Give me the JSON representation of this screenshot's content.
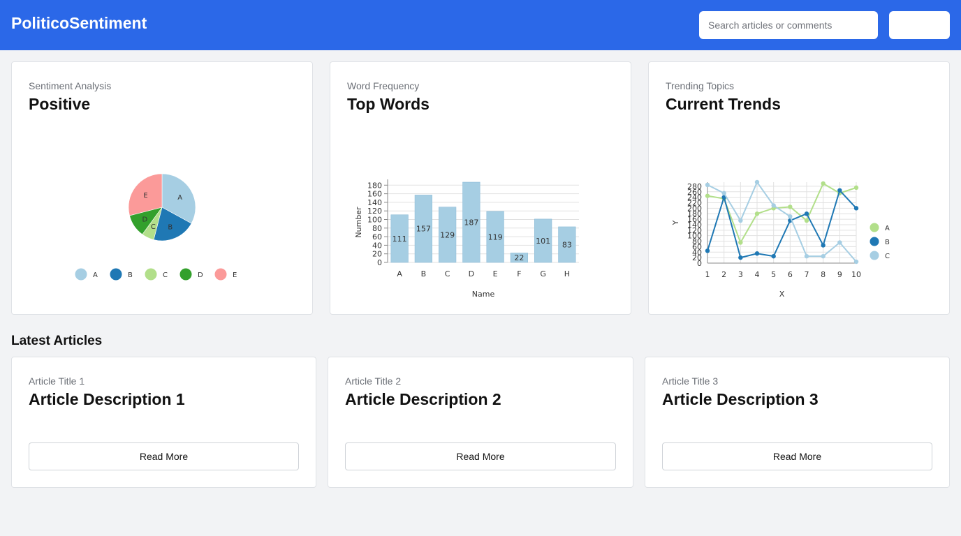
{
  "app": {
    "brand": "PoliticoSentiment",
    "search_placeholder": "Search articles or comments",
    "header_button_label": ""
  },
  "cards": [
    {
      "subtitle": "Sentiment Analysis",
      "title": "Positive"
    },
    {
      "subtitle": "Word Frequency",
      "title": "Top Words"
    },
    {
      "subtitle": "Trending Topics",
      "title": "Current Trends"
    }
  ],
  "latest": {
    "heading": "Latest Articles",
    "articles": [
      {
        "title": "Article Title 1",
        "description": "Article Description 1",
        "button": "Read More"
      },
      {
        "title": "Article Title 2",
        "description": "Article Description 2",
        "button": "Read More"
      },
      {
        "title": "Article Title 3",
        "description": "Article Description 3",
        "button": "Read More"
      }
    ]
  },
  "colors": {
    "header": "#2b68e8",
    "bar": "#a6cee3",
    "grid": "#e1e1e1"
  },
  "chart_data": [
    {
      "type": "pie",
      "categories": [
        "A",
        "B",
        "C",
        "D",
        "E"
      ],
      "values": [
        33,
        21,
        6,
        11,
        29
      ],
      "colors": [
        "#a6cee3",
        "#1f78b4",
        "#b2df8a",
        "#33a02c",
        "#fb9a99"
      ],
      "legend": "bottom"
    },
    {
      "type": "bar",
      "categories": [
        "A",
        "B",
        "C",
        "D",
        "E",
        "F",
        "G",
        "H"
      ],
      "values": [
        111,
        157,
        129,
        187,
        119,
        22,
        101,
        83
      ],
      "xlabel": "Name",
      "ylabel": "Number",
      "ylim": [
        0,
        187
      ],
      "yticks": [
        0,
        20,
        40,
        60,
        80,
        100,
        120,
        140,
        160,
        180
      ],
      "grid": true
    },
    {
      "type": "line",
      "x": [
        1,
        2,
        3,
        4,
        5,
        6,
        7,
        8,
        9,
        10
      ],
      "series": [
        {
          "name": "A",
          "color": "#b2df8a",
          "values": [
            245,
            235,
            75,
            180,
            200,
            205,
            155,
            290,
            255,
            275
          ]
        },
        {
          "name": "B",
          "color": "#1f78b4",
          "values": [
            45,
            240,
            20,
            35,
            25,
            155,
            180,
            65,
            265,
            200
          ]
        },
        {
          "name": "C",
          "color": "#a6cee3",
          "values": [
            285,
            255,
            155,
            295,
            210,
            170,
            25,
            25,
            75,
            5
          ]
        }
      ],
      "xlabel": "X",
      "ylabel": "Y",
      "ylim": [
        0,
        295
      ],
      "yticks": [
        0,
        20,
        40,
        60,
        80,
        100,
        120,
        140,
        160,
        180,
        200,
        220,
        240,
        260,
        280
      ],
      "legend": "right",
      "grid": true
    }
  ]
}
